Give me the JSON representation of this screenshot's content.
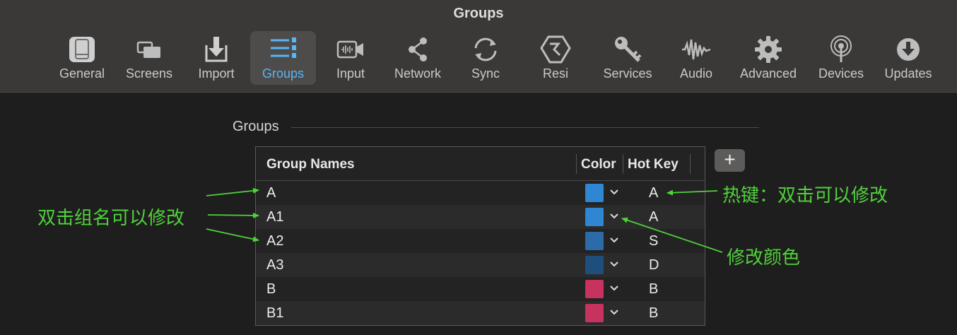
{
  "window": {
    "title": "Groups"
  },
  "toolbar": {
    "items": [
      {
        "label": "General",
        "icon": "general-icon"
      },
      {
        "label": "Screens",
        "icon": "screens-icon"
      },
      {
        "label": "Import",
        "icon": "import-icon"
      },
      {
        "label": "Groups",
        "icon": "groups-icon",
        "active": true
      },
      {
        "label": "Input",
        "icon": "input-icon"
      },
      {
        "label": "Network",
        "icon": "network-icon"
      },
      {
        "label": "Sync",
        "icon": "sync-icon"
      },
      {
        "label": "Resi",
        "icon": "resi-icon"
      },
      {
        "label": "Services",
        "icon": "key-icon"
      },
      {
        "label": "Audio",
        "icon": "waveform-icon"
      },
      {
        "label": "Advanced",
        "icon": "gear-icon"
      },
      {
        "label": "Devices",
        "icon": "antenna-icon"
      },
      {
        "label": "Updates",
        "icon": "download-icon"
      }
    ],
    "active_color": "#57b6f4"
  },
  "section": {
    "title": "Groups"
  },
  "table": {
    "headers": {
      "name": "Group Names",
      "color": "Color",
      "hotkey": "Hot Key"
    },
    "rows": [
      {
        "name": "A",
        "color": "#2f86d3",
        "hotkey": "A"
      },
      {
        "name": "A1",
        "color": "#2f86d3",
        "hotkey": "A"
      },
      {
        "name": "A2",
        "color": "#2b6ca8",
        "hotkey": "S"
      },
      {
        "name": "A3",
        "color": "#1e4e7c",
        "hotkey": "D"
      },
      {
        "name": "B",
        "color": "#c8325f",
        "hotkey": "B"
      },
      {
        "name": "B1",
        "color": "#c8325f",
        "hotkey": "B"
      }
    ]
  },
  "add_button": {
    "label": "+"
  },
  "annotations": {
    "rename": "双击组名可以修改",
    "hotkey": "热键：双击可以修改",
    "color": "修改颜色",
    "color_hex": "#4fd23b"
  }
}
